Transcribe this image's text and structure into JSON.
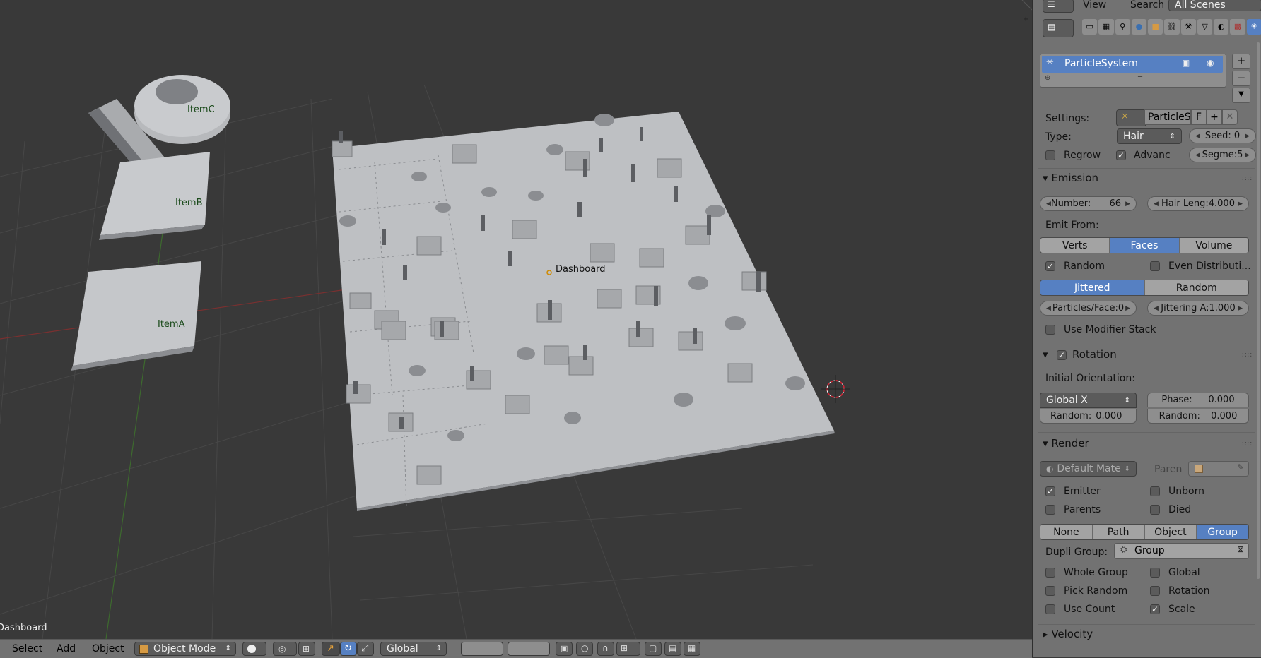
{
  "viewport": {
    "objects": [
      "ItemC",
      "ItemB",
      "ItemA"
    ],
    "dashboard_label": "Dashboard",
    "corner_label": "Dashboard"
  },
  "bottom_bar": {
    "menus": [
      "Select",
      "Add",
      "Object"
    ],
    "mode": "Object Mode",
    "orientation": "Global"
  },
  "header": {
    "view": "View",
    "search": "Search",
    "scenes": "All Scenes"
  },
  "particle_system": {
    "name": "ParticleSystem",
    "settings_label": "Settings:",
    "settings_value": "ParticleSe",
    "settings_fake": "F",
    "type_label": "Type:",
    "type_value": "Hair",
    "seed": "Seed: 0",
    "regrow": "Regrow",
    "advanced": "Advanc",
    "segments": "Segme:5"
  },
  "emission": {
    "title": "Emission",
    "number_label": "Number:",
    "number_value": "66",
    "hair_length": "Hair Leng:4.000",
    "emit_from_label": "Emit From:",
    "emit_from_options": [
      "Verts",
      "Faces",
      "Volume"
    ],
    "emit_from_active": "Faces",
    "random": "Random",
    "even_distribution": "Even Distributi...",
    "distribution_options": [
      "Jittered",
      "Random"
    ],
    "distribution_active": "Jittered",
    "particles_face": "Particles/Face:0",
    "jittering": "Jittering A:1.000",
    "use_modifier_stack": "Use Modifier Stack"
  },
  "rotation": {
    "title": "Rotation",
    "initial_orientation_label": "Initial Orientation:",
    "orientation_value": "Global X",
    "phase_label": "Phase:",
    "phase_value": "0.000",
    "random1_label": "Random:",
    "random1_value": "0.000",
    "random2_label": "Random:",
    "random2_value": "0.000"
  },
  "render": {
    "title": "Render",
    "material": "Default Mate",
    "parent": "Paren",
    "emitter": "Emitter",
    "unborn": "Unborn",
    "parents": "Parents",
    "died": "Died",
    "render_as_options": [
      "None",
      "Path",
      "Object",
      "Group"
    ],
    "render_as_active": "Group",
    "dupli_group_label": "Dupli Group:",
    "dupli_group_value": "Group",
    "whole_group": "Whole Group",
    "global": "Global",
    "pick_random": "Pick Random",
    "rotation": "Rotation",
    "use_count": "Use Count",
    "scale": "Scale"
  },
  "velocity": {
    "title": "Velocity"
  }
}
